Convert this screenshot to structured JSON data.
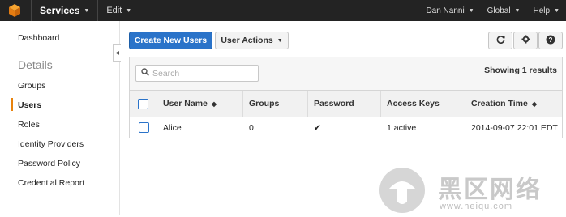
{
  "topbar": {
    "logo_icon": "aws-cube-icon",
    "services": "Services",
    "edit": "Edit",
    "user": "Dan Nanni",
    "region": "Global",
    "help": "Help"
  },
  "sidebar": {
    "dashboard": "Dashboard",
    "section_title": "Details",
    "items": [
      "Groups",
      "Users",
      "Roles",
      "Identity Providers",
      "Password Policy",
      "Credential Report"
    ],
    "active_index": 1,
    "accent": "#e8820c"
  },
  "toolbar": {
    "create_label": "Create New Users",
    "actions_label": "User Actions",
    "refresh_icon": "refresh-icon",
    "settings_icon": "gear-icon",
    "help_icon": "help-icon",
    "primary_color": "#2a73c9"
  },
  "search": {
    "placeholder": "Search",
    "value": ""
  },
  "results_text": "Showing 1 results",
  "table": {
    "headers": [
      "User Name",
      "Groups",
      "Password",
      "Access Keys",
      "Creation Time"
    ],
    "rows": [
      {
        "user_name": "Alice",
        "groups": "0",
        "password": "✔",
        "access_keys": "1 active",
        "creation_time": "2014-09-07 22:01 EDT"
      }
    ]
  },
  "watermark": {
    "title": "黑区网络",
    "url": "www.heiqu.com"
  }
}
